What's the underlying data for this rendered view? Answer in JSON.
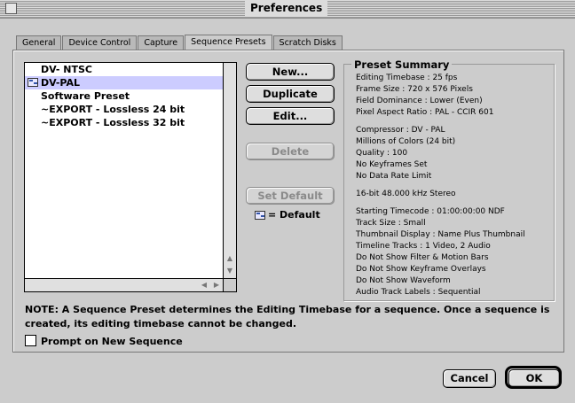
{
  "window": {
    "title": "Preferences"
  },
  "tabs": [
    {
      "label": "General"
    },
    {
      "label": "Device Control"
    },
    {
      "label": "Capture"
    },
    {
      "label": "Sequence Presets",
      "active": true
    },
    {
      "label": "Scratch Disks"
    }
  ],
  "presets": [
    {
      "label": "DV- NTSC",
      "default": false,
      "selected": false
    },
    {
      "label": "DV-PAL",
      "default": true,
      "selected": true
    },
    {
      "label": "Software Preset",
      "default": false,
      "selected": false
    },
    {
      "label": "~EXPORT - Lossless 24 bit",
      "default": false,
      "selected": false
    },
    {
      "label": "~EXPORT - Lossless 32 bit",
      "default": false,
      "selected": false
    }
  ],
  "buttons": {
    "new": "New...",
    "duplicate": "Duplicate",
    "edit": "Edit...",
    "delete": "Delete",
    "set_default": "Set Default",
    "cancel": "Cancel",
    "ok": "OK"
  },
  "default_legend": "= Default",
  "summary": {
    "title": "Preset Summary",
    "group1": [
      "Editing Timebase : 25 fps",
      "Frame Size : 720 x 576 Pixels",
      "Field Dominance : Lower (Even)",
      "Pixel Aspect Ratio : PAL - CCIR 601"
    ],
    "group2": [
      "Compressor : DV - PAL",
      "Millions of Colors (24 bit)",
      "Quality : 100",
      "No Keyframes Set",
      "No Data Rate Limit"
    ],
    "group3": [
      "16-bit 48.000 kHz Stereo"
    ],
    "group4": [
      "Starting Timecode : 01:00:00:00 NDF",
      "Track Size : Small",
      "Thumbnail Display : Name Plus Thumbnail",
      "Timeline Tracks : 1 Video, 2 Audio",
      "Do Not Show Filter & Motion Bars",
      "Do Not Show Keyframe Overlays",
      "Do Not Show Waveform",
      "Audio Track Labels : Sequential"
    ]
  },
  "note": "NOTE: A Sequence Preset determines the Editing Timebase for a sequence.  Once a sequence is created, its editing timebase cannot be changed.",
  "prompt_checkbox": {
    "label": "Prompt on New Sequence",
    "checked": false
  }
}
